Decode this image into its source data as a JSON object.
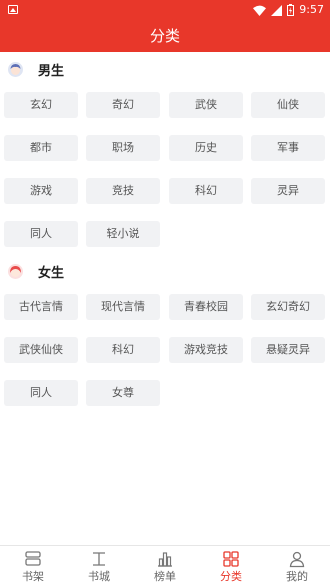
{
  "status": {
    "time": "9:57"
  },
  "header": {
    "title": "分类"
  },
  "male": {
    "title": "男生",
    "items": [
      "玄幻",
      "奇幻",
      "武侠",
      "仙侠",
      "都市",
      "职场",
      "历史",
      "军事",
      "游戏",
      "竞技",
      "科幻",
      "灵异",
      "同人",
      "轻小说"
    ]
  },
  "female": {
    "title": "女生",
    "items": [
      "古代言情",
      "现代言情",
      "青春校园",
      "玄幻奇幻",
      "武侠仙侠",
      "科幻",
      "游戏竞技",
      "悬疑灵异",
      "同人",
      "女尊"
    ]
  },
  "tabs": [
    {
      "label": "书架",
      "icon": "bookshelf-icon"
    },
    {
      "label": "书城",
      "icon": "bookstore-icon"
    },
    {
      "label": "榜单",
      "icon": "ranking-icon"
    },
    {
      "label": "分类",
      "icon": "category-icon",
      "active": true
    },
    {
      "label": "我的",
      "icon": "profile-icon"
    }
  ],
  "colors": {
    "accent": "#e8372a",
    "chip_bg": "#f1f2f4"
  }
}
